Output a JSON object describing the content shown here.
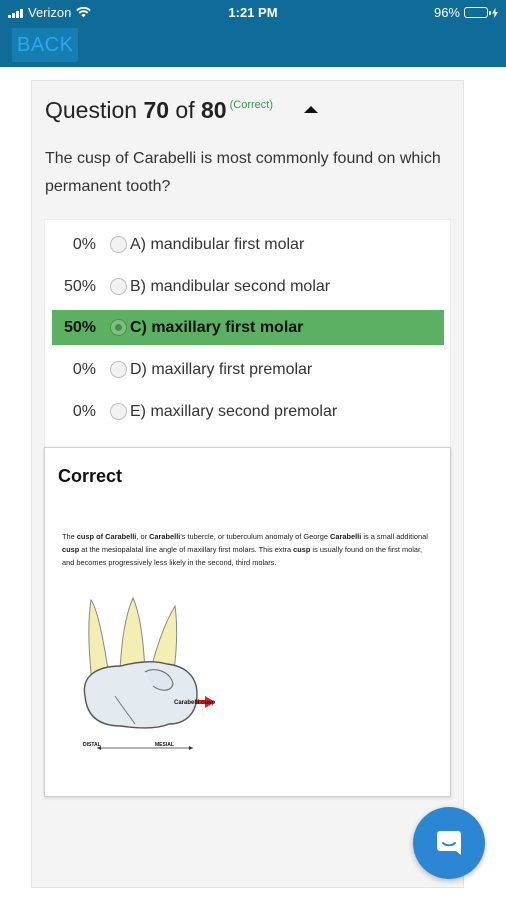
{
  "status_bar": {
    "carrier": "Verizon",
    "time": "1:21 PM",
    "battery": "96%",
    "battery_level": 0.96,
    "icons": [
      "signal-icon",
      "wifi-icon",
      "battery-icon",
      "charging-icon"
    ]
  },
  "nav": {
    "back_label": "BACK"
  },
  "question": {
    "prefix": "Question ",
    "number": "70",
    "of_label": " of ",
    "total": "80",
    "verdict": "(Correct)",
    "text": "The cusp of Carabelli is most commonly found on which permanent tooth?"
  },
  "answers": [
    {
      "pct": "0%",
      "label": "A) mandibular first molar",
      "selected": false
    },
    {
      "pct": "50%",
      "label": "B) mandibular second molar",
      "selected": false
    },
    {
      "pct": "50%",
      "label": "C) maxillary first molar",
      "selected": true
    },
    {
      "pct": "0%",
      "label": "D) maxillary first premolar",
      "selected": false
    },
    {
      "pct": "0%",
      "label": "E) maxillary second premolar",
      "selected": false
    }
  ],
  "explanation": {
    "title": "Correct",
    "body": {
      "p1": "The ",
      "b1": "cusp of Carabelli",
      "p2": ", or ",
      "b2": "Carabelli",
      "p3": "'s tubercle, or tuberculum anomaly of George ",
      "b3": "Carabelli",
      "p4": " is a small additional ",
      "b4": "cusp",
      "p5": " at the mesiopalatal line angle of maxillary first molars. This extra ",
      "b5": "cusp",
      "p6": " is usually found on the first molar, and becomes progressively less likely in the second, third molars."
    },
    "figure_labels": {
      "cusp": "Carabelli cusp",
      "distal": "DISTAL",
      "mesial": "MESIAL"
    },
    "colors": {
      "root": "#f3efb3",
      "crown": "#e3eaf0",
      "arrow": "#e02020"
    }
  },
  "colors": {
    "nav_bar": "#0f6b98",
    "back_button": "#157db2",
    "correct_green": "#5cb061",
    "verdict_text": "#3d9a46",
    "chat_fab": "#2b87d3"
  }
}
